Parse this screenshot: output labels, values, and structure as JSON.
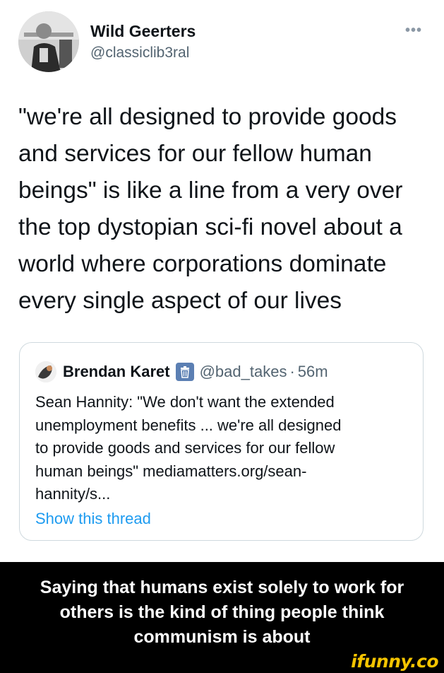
{
  "tweet": {
    "author_name": "Wild Geerters",
    "author_handle": "@classiclib3ral",
    "more_icon": "more-options-icon",
    "text": "\"we're all designed to provide goods\nand services for our fellow human\nbeings\" is like a line from a very over\nthe top dystopian sci-fi novel about a\nworld where corporations dominate\nevery single aspect of our lives"
  },
  "quoted_tweet": {
    "author_name": "Brendan Karet",
    "badge_icon": "trash-can-icon",
    "author_handle": "@bad_takes",
    "separator": "·",
    "time": "56m",
    "text": "Sean Hannity: \"We don't want the extended\nunemployment benefits ... we're all designed\nto provide goods and services for our fellow\nhuman beings\" mediamatters.org/sean-\nhannity/s...",
    "show_thread_label": "Show this thread",
    "link_color": "#1d9bf0"
  },
  "caption": {
    "text": "Saying that humans exist solely to work for\nothers is the kind of thing people think\ncommunism is about"
  },
  "watermark": {
    "text": "ifunny.co"
  }
}
